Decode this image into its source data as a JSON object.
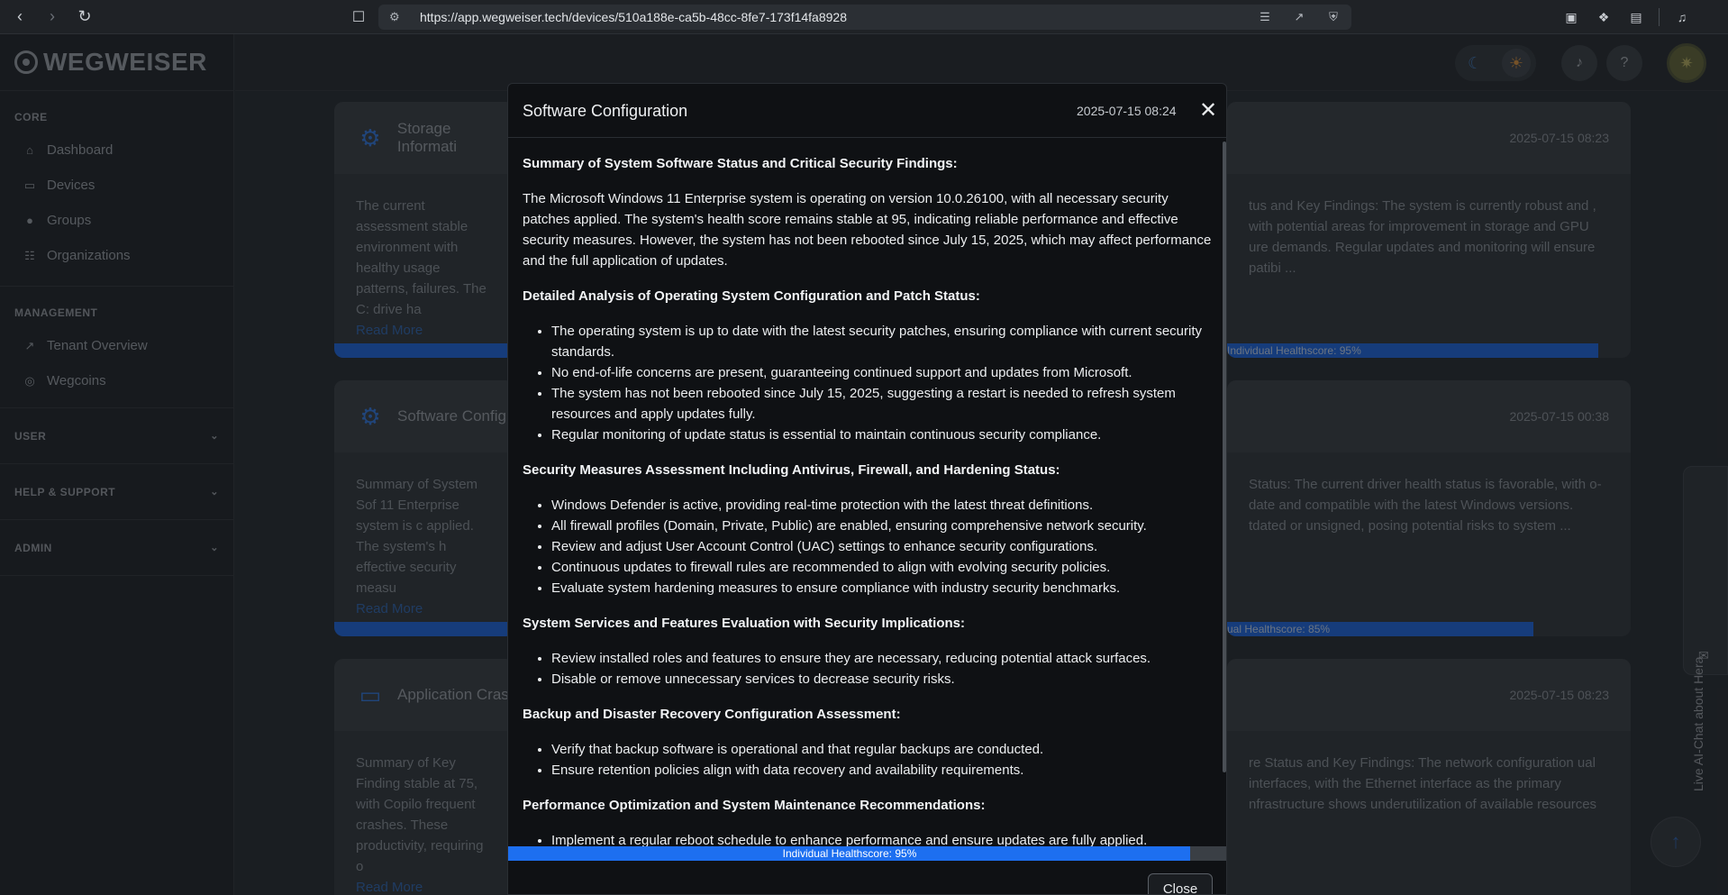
{
  "browser": {
    "url": "https://app.wegweiser.tech/devices/510a188e-ca5b-48cc-8fe7-173f14fa8928"
  },
  "sidebar": {
    "brand": "WEGWEISER",
    "sections": [
      {
        "label": "CORE",
        "items": [
          {
            "label": "Dashboard",
            "icon": "home-icon"
          },
          {
            "label": "Devices",
            "icon": "laptop-icon"
          },
          {
            "label": "Groups",
            "icon": "users-icon"
          },
          {
            "label": "Organizations",
            "icon": "sitemap-icon"
          }
        ]
      },
      {
        "label": "MANAGEMENT",
        "items": [
          {
            "label": "Tenant Overview",
            "icon": "chart-icon"
          },
          {
            "label": "Wegcoins",
            "icon": "coins-icon"
          }
        ]
      }
    ],
    "collapsibles": [
      "USER",
      "HELP & SUPPORT",
      "ADMIN"
    ]
  },
  "background_cards": [
    {
      "title": "Storage Informati",
      "date": "",
      "body": "The current assessment stable environment with healthy usage patterns, failures. The C: drive ha",
      "link": "Read More",
      "progress": 95
    },
    {
      "title": "",
      "date": "2025-07-15 08:23",
      "body": "tus and Key Findings: The system is currently robust and , with potential areas for improvement in storage and GPU ure demands. Regular updates and monitoring will ensure patibi ...",
      "link": "",
      "progress_label": "Individual Healthscore: 95%",
      "progress": 95
    },
    {
      "title": "Software Config",
      "date": "",
      "body": "Summary of System Sof 11 Enterprise system is c applied. The system's h effective security measu",
      "link": "Read More",
      "progress": 95
    },
    {
      "title": "",
      "date": "2025-07-15 00:38",
      "body": "Status: The current driver health status is favorable, with o-date and compatible with the latest Windows versions. tdated or unsigned, posing potential risks to system ...",
      "link": "",
      "progress_label": "ual Healthscore: 85%",
      "progress": 85
    },
    {
      "title": "Application Cras",
      "date": "",
      "body": "Summary of Key Finding stable at 75, with Copilo frequent crashes. These productivity, requiring o",
      "link": "Read More",
      "progress": 75
    },
    {
      "title": "",
      "date": "2025-07-15 08:23",
      "body": "re Status and Key Findings: The network configuration ual interfaces, with the Ethernet interface as the primary nfrastructure shows underutilization of available resources",
      "link": "",
      "progress": 0
    }
  ],
  "chat_tab": {
    "label": "Live AI-Chat about Hera"
  },
  "modal": {
    "title": "Software Configuration",
    "date": "2025-07-15 08:24",
    "close_label": "Close",
    "health_label": "Individual Healthscore: 95%",
    "health_value": 95,
    "sections": [
      {
        "heading": "Summary of System Software Status and Critical Security Findings:",
        "paragraph": "The Microsoft Windows 11 Enterprise system is operating on version 10.0.26100, with all necessary security patches applied. The system's health score remains stable at 95, indicating reliable performance and effective security measures. However, the system has not been rebooted since July 15, 2025, which may affect performance and the full application of updates."
      },
      {
        "heading": "Detailed Analysis of Operating System Configuration and Patch Status:",
        "bullets": [
          "The operating system is up to date with the latest security patches, ensuring compliance with current security standards.",
          "No end-of-life concerns are present, guaranteeing continued support and updates from Microsoft.",
          "The system has not been rebooted since July 15, 2025, suggesting a restart is needed to refresh system resources and apply updates fully.",
          "Regular monitoring of update status is essential to maintain continuous security compliance."
        ]
      },
      {
        "heading": "Security Measures Assessment Including Antivirus, Firewall, and Hardening Status:",
        "bullets": [
          "Windows Defender is active, providing real-time protection with the latest threat definitions.",
          "All firewall profiles (Domain, Private, Public) are enabled, ensuring comprehensive network security.",
          "Review and adjust User Account Control (UAC) settings to enhance security configurations.",
          "Continuous updates to firewall rules are recommended to align with evolving security policies.",
          "Evaluate system hardening measures to ensure compliance with industry security benchmarks."
        ]
      },
      {
        "heading": "System Services and Features Evaluation with Security Implications:",
        "bullets": [
          "Review installed roles and features to ensure they are necessary, reducing potential attack surfaces.",
          "Disable or remove unnecessary services to decrease security risks."
        ]
      },
      {
        "heading": "Backup and Disaster Recovery Configuration Assessment:",
        "bullets": [
          "Verify that backup software is operational and that regular backups are conducted.",
          "Ensure retention policies align with data recovery and availability requirements."
        ]
      },
      {
        "heading": "Performance Optimization and System Maintenance Recommendations:",
        "bullets": [
          "Implement a regular reboot schedule to enhance performance and ensure updates are fully applied."
        ]
      }
    ]
  },
  "colors": {
    "accent": "#1d6ff0",
    "modal_bg": "#0f1114",
    "sidebar_bg": "#1e2227"
  }
}
